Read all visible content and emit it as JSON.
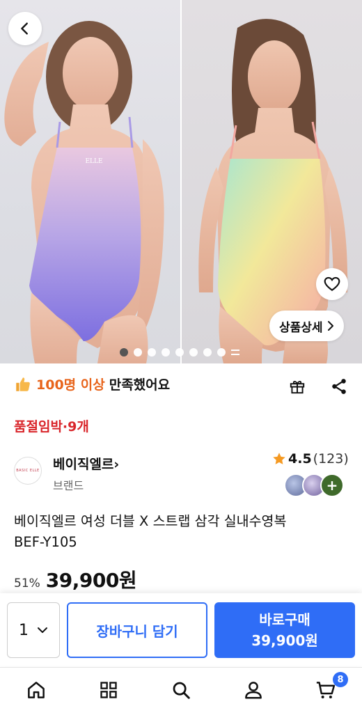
{
  "gallery": {
    "detail_label": "상품상세",
    "left_logo": "ELLE",
    "dot_count": 8,
    "active_index": 0
  },
  "satisfaction": {
    "highlight": "100명 이상",
    "suffix": "만족했어요"
  },
  "stock_alert": "품절임박·9개",
  "brand": {
    "name": "베이직엘르",
    "chevron": "›",
    "type": "브랜드",
    "logo_text": "BASIC ELLE"
  },
  "rating": {
    "score": "4.5",
    "count": "(123)"
  },
  "reviews": {
    "more_label": "+"
  },
  "product": {
    "title_line1": "베이직엘르 여성 더블 X 스트랩 삼각 실내수영복",
    "title_line2": "BEF-Y105"
  },
  "price": {
    "discount": "51%",
    "amount": "39,900원"
  },
  "purchase": {
    "quantity": "1",
    "cart_label": "장바구니 담기",
    "buy_label": "바로구매",
    "buy_price": "39,900원"
  },
  "nav": {
    "cart_badge": "8"
  },
  "colors": {
    "accent": "#2f6df6",
    "alert": "#d9252a",
    "highlight": "#e8641b",
    "star": "#f59a23"
  }
}
